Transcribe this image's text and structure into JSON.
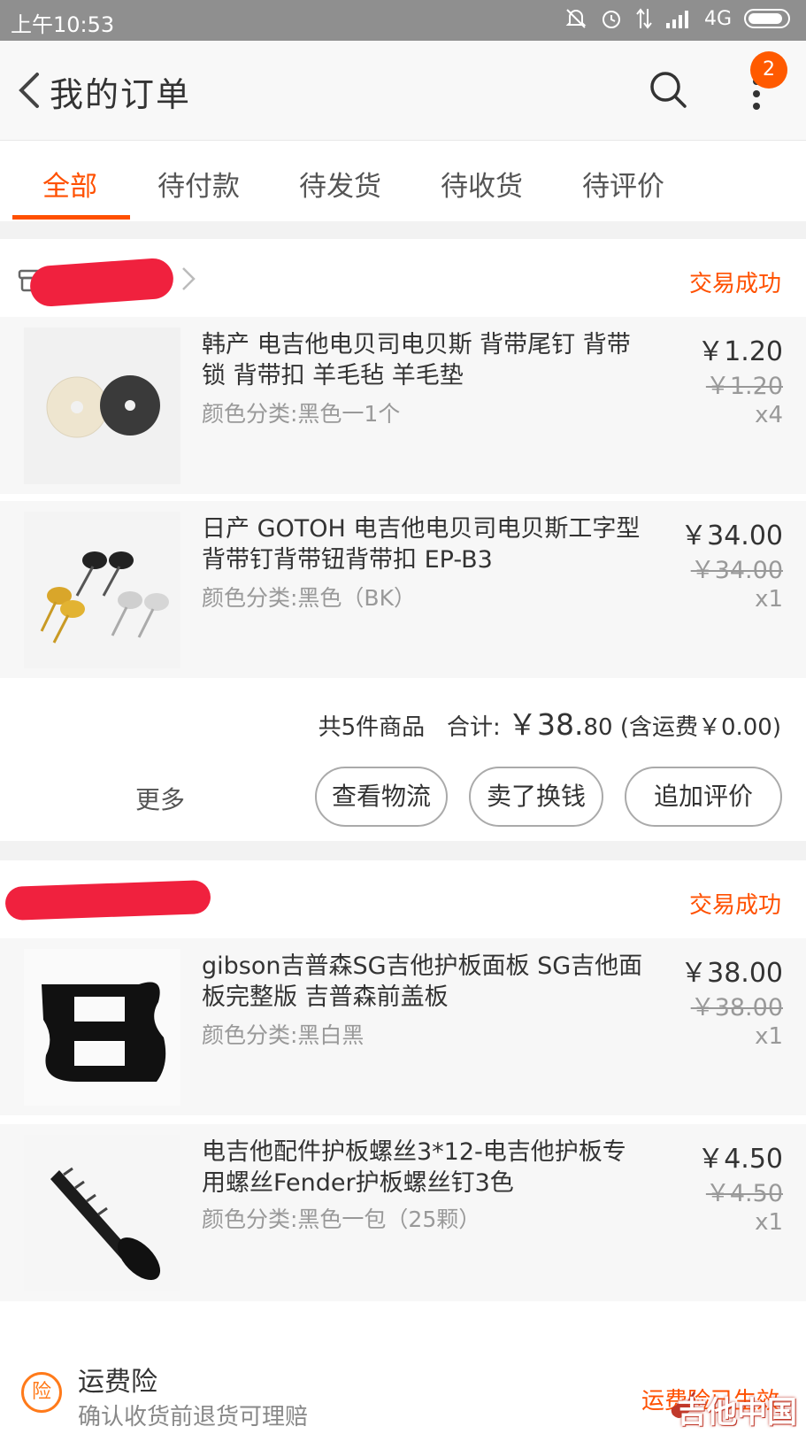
{
  "status_bar": {
    "time": "上午10:53",
    "network": "4G"
  },
  "header": {
    "title": "我的订单",
    "badge": "2"
  },
  "tabs": [
    {
      "label": "全部",
      "active": true
    },
    {
      "label": "待付款",
      "active": false
    },
    {
      "label": "待发货",
      "active": false
    },
    {
      "label": "待收货",
      "active": false
    },
    {
      "label": "待评价",
      "active": false
    }
  ],
  "orders": [
    {
      "status": "交易成功",
      "items": [
        {
          "title": "韩产 电吉他电贝司电贝斯 背带尾钉 背带锁 背带扣 羊毛毡 羊毛垫",
          "sku": "颜色分类:黑色一1个",
          "price": "￥1.20",
          "original_price": "￥1.20",
          "qty": "x4"
        },
        {
          "title": "日产 GOTOH 电吉他电贝司电贝斯工字型 背带钉背带钮背带扣 EP-B3",
          "sku": "颜色分类:黑色（BK）",
          "price": "￥34.00",
          "original_price": "￥34.00",
          "qty": "x1"
        }
      ],
      "summary": {
        "count": "共5件商品",
        "total_label": "合计:",
        "total_int": "￥38.",
        "total_dec": "80",
        "shipping": "(含运费￥0.00)"
      },
      "actions": {
        "more": "更多",
        "logistics": "查看物流",
        "resell": "卖了换钱",
        "review": "追加评价"
      }
    },
    {
      "status": "交易成功",
      "items": [
        {
          "title": "gibson吉普森SG吉他护板面板 SG吉他面板完整版 吉普森前盖板",
          "sku": "颜色分类:黑白黑",
          "price": "￥38.00",
          "original_price": "￥38.00",
          "qty": "x1"
        },
        {
          "title": "电吉他配件护板螺丝3*12-电吉他护板专用螺丝Fender护板螺丝钉3色",
          "sku": "颜色分类:黑色一包（25颗）",
          "price": "￥4.50",
          "original_price": "￥4.50",
          "qty": "x1"
        }
      ]
    }
  ],
  "insurance": {
    "icon_text": "险",
    "title": "运费险",
    "subtitle": "确认收货前退货可理赔",
    "status": "运费险已生效"
  },
  "watermark": {
    "text": "吉他中国"
  },
  "colors": {
    "accent": "#ff5000",
    "redaction": "#f0213e"
  }
}
